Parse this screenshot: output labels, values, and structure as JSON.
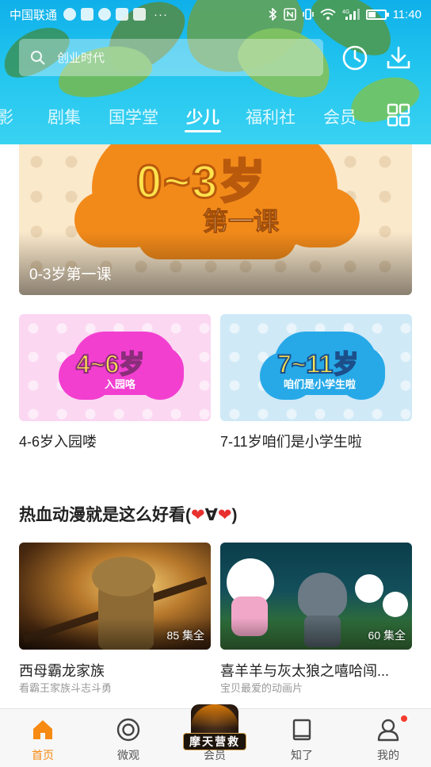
{
  "status_bar": {
    "carrier": "中国联通",
    "more": "···",
    "time": "11:40",
    "network": "4G"
  },
  "search": {
    "placeholder": "创业时代"
  },
  "tabs": [
    {
      "label": "影"
    },
    {
      "label": "剧集"
    },
    {
      "label": "国学堂"
    },
    {
      "label": "少儿"
    },
    {
      "label": "福利社"
    },
    {
      "label": "会员"
    }
  ],
  "active_tab_index": 3,
  "banner": {
    "art_title": "0~3岁",
    "art_subtitle": "第一课",
    "caption": "0-3岁第一课"
  },
  "age_cards": [
    {
      "art_age": "4~6岁",
      "art_tag": "入园咯",
      "title": "4-6岁入园喽"
    },
    {
      "art_age": "7~11岁",
      "art_tag": "咱们是小学生啦",
      "title": "7-11岁咱们是小学生啦"
    }
  ],
  "section": {
    "title_prefix": "热血动漫就是这么好看(",
    "heart": "❤",
    "title_mid": "∀",
    "title_suffix": ")"
  },
  "videos": [
    {
      "title": "西母霸龙家族",
      "subtitle": "看霸王家族斗志斗勇",
      "count": "85 集全"
    },
    {
      "title": "喜羊羊与灰太狼之嘻哈闯...",
      "subtitle": "宝贝最爱的动画片",
      "count": "60 集全"
    }
  ],
  "bottom_nav": [
    {
      "label": "首页",
      "active": true
    },
    {
      "label": "微观"
    },
    {
      "label": "会员",
      "badge_text": "摩天营救"
    },
    {
      "label": "知了"
    },
    {
      "label": "我的",
      "has_dot": true
    }
  ],
  "colors": {
    "header_blue": "#1bbdee",
    "accent_orange": "#f78a12",
    "notification_red": "#f53b2f"
  }
}
